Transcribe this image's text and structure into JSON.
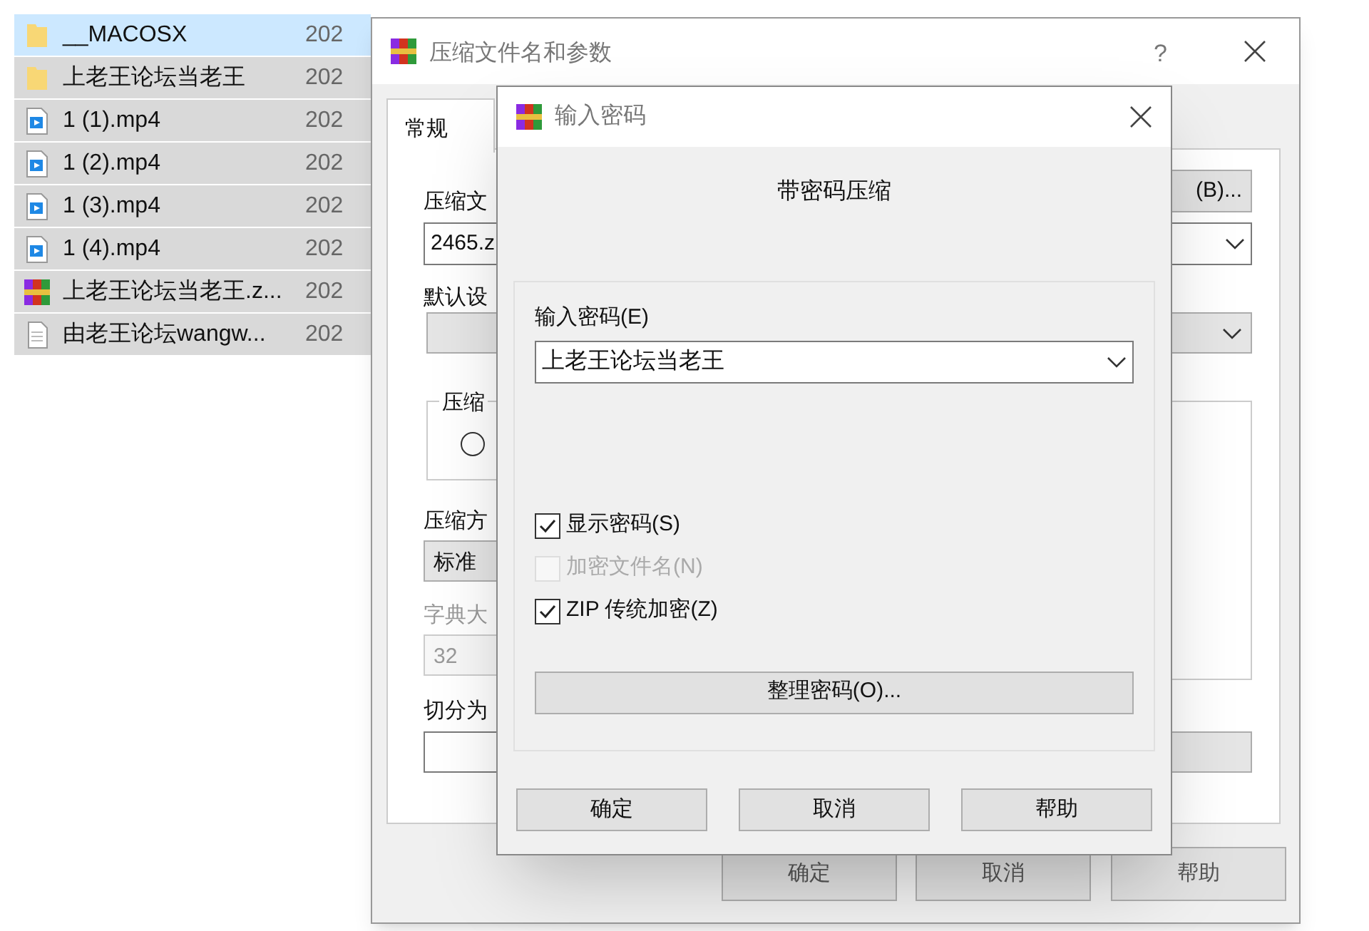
{
  "file_list": {
    "rows": [
      {
        "name": "__MACOSX",
        "date": "202",
        "kind": "folder",
        "selected": true,
        "focused": true
      },
      {
        "name": "上老王论坛当老王",
        "date": "202",
        "kind": "folder",
        "selected": true,
        "focused": false
      },
      {
        "name": "1 (1).mp4",
        "date": "202",
        "kind": "video",
        "selected": true,
        "focused": false
      },
      {
        "name": "1 (2).mp4",
        "date": "202",
        "kind": "video",
        "selected": true,
        "focused": false
      },
      {
        "name": "1 (3).mp4",
        "date": "202",
        "kind": "video",
        "selected": true,
        "focused": false
      },
      {
        "name": "1 (4).mp4",
        "date": "202",
        "kind": "video",
        "selected": true,
        "focused": false
      },
      {
        "name": "上老王论坛当老王.z...",
        "date": "202",
        "kind": "archive",
        "selected": true,
        "focused": false
      },
      {
        "name": "由老王论坛wangw...",
        "date": "202",
        "kind": "text",
        "selected": true,
        "focused": false
      }
    ]
  },
  "archive_dialog": {
    "title": "压缩文件名和参数",
    "help": "?",
    "tabs": [
      {
        "label": "常规",
        "selected": true
      }
    ],
    "archive_name_label": "压缩文",
    "browse_button": "(B)...",
    "archive_name_value": "2465.z",
    "profile_label": "默认设",
    "format_group_label": "压缩",
    "format_radio": {
      "selected": false
    },
    "method_label": "压缩方",
    "method_value": "标准",
    "dictionary_label": "字典大",
    "dictionary_value": "32",
    "split_label": "切分为",
    "buttons": [
      "确定",
      "取消",
      "帮助"
    ]
  },
  "password_dialog": {
    "title": "输入密码",
    "heading": "带密码压缩",
    "password_label": "输入密码(E)",
    "password_value": "上老王论坛当老王",
    "options": [
      {
        "label": "显示密码(S)",
        "checked": true,
        "disabled": false
      },
      {
        "label": "加密文件名(N)",
        "checked": false,
        "disabled": true
      },
      {
        "label": "ZIP 传统加密(Z)",
        "checked": true,
        "disabled": false
      }
    ],
    "organize_button": "整理密码(O)...",
    "buttons": [
      "确定",
      "取消",
      "帮助"
    ]
  }
}
